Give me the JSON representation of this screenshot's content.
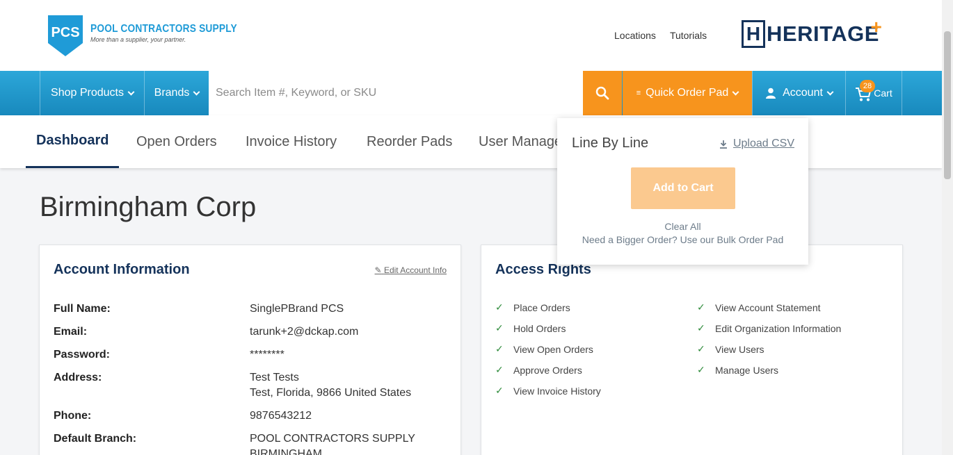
{
  "header": {
    "logo_mark": "PCS",
    "logo_title": "POOL CONTRACTORS SUPPLY",
    "logo_tagline": "More than a supplier, your partner.",
    "links": [
      "Locations",
      "Tutorials"
    ],
    "partner_logo": "HERITAGE"
  },
  "nav": {
    "shop_products": "Shop Products",
    "brands": "Brands",
    "search_placeholder": "Search Item #, Keyword, or SKU",
    "quick_order_pad": "Quick Order Pad",
    "account": "Account",
    "cart": "Cart",
    "cart_count": "28"
  },
  "tabs": [
    "Dashboard",
    "Open Orders",
    "Invoice History",
    "Reorder Pads",
    "User Manage"
  ],
  "page_title": "Birmingham Corp",
  "account_info": {
    "title": "Account Information",
    "edit_label": "Edit Account Info",
    "rows": [
      {
        "label": "Full Name:",
        "value": "SinglePBrand PCS"
      },
      {
        "label": "Email:",
        "value": "tarunk+2@dckap.com"
      },
      {
        "label": "Password:",
        "value": "********"
      },
      {
        "label": "Address:",
        "value": "Test Tests",
        "value2": "Test, Florida, 9866 United States"
      },
      {
        "label": "Phone:",
        "value": "9876543212"
      },
      {
        "label": "Default Branch:",
        "value": "POOL CONTRACTORS SUPPLY",
        "value2": "BIRMINGHAM"
      }
    ]
  },
  "access_rights": {
    "title": "Access Rights",
    "left": [
      "Place Orders",
      "Hold Orders",
      "View Open Orders",
      "Approve Orders",
      "View Invoice History"
    ],
    "right": [
      "View Account Statement",
      "Edit Organization Information",
      "View Users",
      "Manage Users"
    ]
  },
  "quick_order_dropdown": {
    "title": "Line By Line",
    "upload": "Upload CSV",
    "add_to_cart": "Add to Cart",
    "clear_all": "Clear All",
    "bulk": "Need a Bigger Order? Use our Bulk Order Pad"
  },
  "colors": {
    "brand_blue": "#1f9bd7",
    "navy": "#14325a",
    "orange": "#f7941d"
  }
}
